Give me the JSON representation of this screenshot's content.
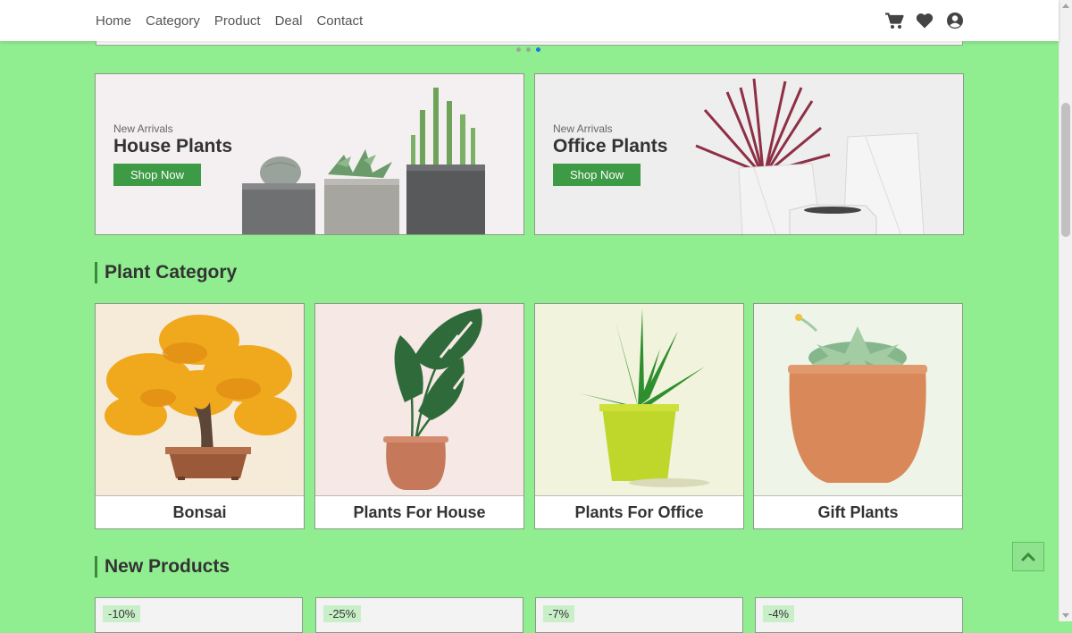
{
  "nav": {
    "links": [
      "Home",
      "Category",
      "Product",
      "Deal",
      "Contact"
    ],
    "icons": [
      "cart-icon",
      "heart-icon",
      "user-icon"
    ]
  },
  "carousel": {
    "dots": 3,
    "active_dot": 3
  },
  "banners": [
    {
      "subtitle": "New Arrivals",
      "title": "House Plants",
      "button": "Shop Now"
    },
    {
      "subtitle": "New Arrivals",
      "title": "Office Plants",
      "button": "Shop Now"
    }
  ],
  "sections": {
    "category_title": "Plant Category",
    "products_title": "New Products"
  },
  "categories": [
    {
      "label": "Bonsai",
      "bg": "#f6ead8"
    },
    {
      "label": "Plants For House",
      "bg": "#f6e8e4"
    },
    {
      "label": "Plants For Office",
      "bg": "#f1f3dc"
    },
    {
      "label": "Gift Plants",
      "bg": "#eef5e8"
    }
  ],
  "products": [
    {
      "discount": "-10%"
    },
    {
      "discount": "-25%"
    },
    {
      "discount": "-7%"
    },
    {
      "discount": "-4%"
    }
  ],
  "colors": {
    "page_bg": "#90ee90",
    "accent_green": "#3d9a45",
    "active_dot": "#1a73e8"
  },
  "back_to_top_icon": "chevron-up-icon"
}
